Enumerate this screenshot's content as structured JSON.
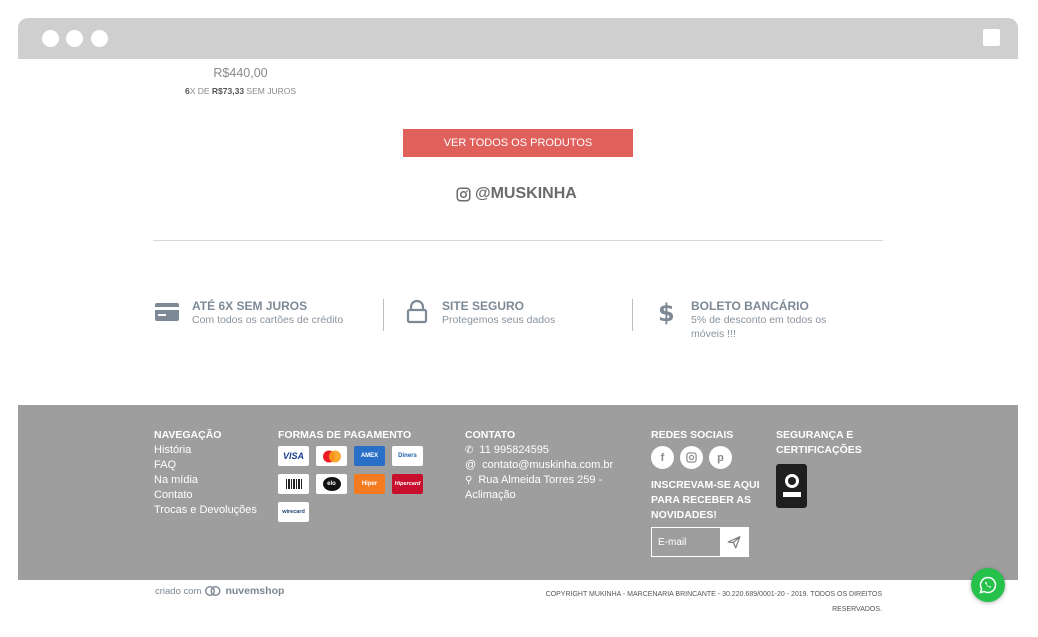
{
  "product": {
    "price": "R$440,00",
    "installments_prefix": "6",
    "installments_mid": "X DE ",
    "installments_value": "R$73,33",
    "installments_suffix": " SEM JUROS"
  },
  "cta": {
    "label": "VER TODOS OS PRODUTOS"
  },
  "instagram": {
    "handle": "@MUSKINHA"
  },
  "features": [
    {
      "title": "ATÉ 6X SEM JUROS",
      "subtitle": "Com todos os cartões de crédito",
      "icon": "credit-card-icon"
    },
    {
      "title": "SITE SEGURO",
      "subtitle": "Protegemos seus dados",
      "icon": "lock-icon"
    },
    {
      "title": "BOLETO BANCÁRIO",
      "subtitle": "5% de desconto em todos os móveis !!!",
      "icon": "dollar-icon"
    }
  ],
  "footer": {
    "nav_title": "NAVEGAÇÃO",
    "nav_items": [
      "História",
      "FAQ",
      "Na mídia",
      "Contato",
      "Trocas e Devoluções"
    ],
    "payment_title": "FORMAS DE PAGAMENTO",
    "payment_methods": [
      "VISA",
      "mastercard",
      "AMEX",
      "Diners",
      "boleto",
      "elo",
      "Hiper",
      "Hipercard",
      "wirecard"
    ],
    "contact_title": "CONTATO",
    "phone": "11 995824595",
    "email": "contato@muskinha.com.br",
    "address": "Rua Almeida Torres 259 - Aclimação",
    "social_title": "REDES SOCIAIS",
    "social": [
      "f",
      "ig",
      "p"
    ],
    "newsletter_title": "INSCREVAM-SE AQUI PARA RECEBER AS NOVIDADES!",
    "email_placeholder": "E-mail",
    "security_title": "SEGURANÇA E CERTIFICAÇÕES"
  },
  "bottom": {
    "criado": "criado com",
    "brand": "nuvemshop",
    "copyright": "COPYRIGHT MUKINHA - MARCENARIA BRINCANTE - 30.220.689/0001-20 - 2019. TODOS OS DIREITOS RESERVADOS."
  },
  "colors": {
    "accent": "#e0615b",
    "footer_bg": "#9e9e9e",
    "whatsapp": "#25c14b"
  }
}
